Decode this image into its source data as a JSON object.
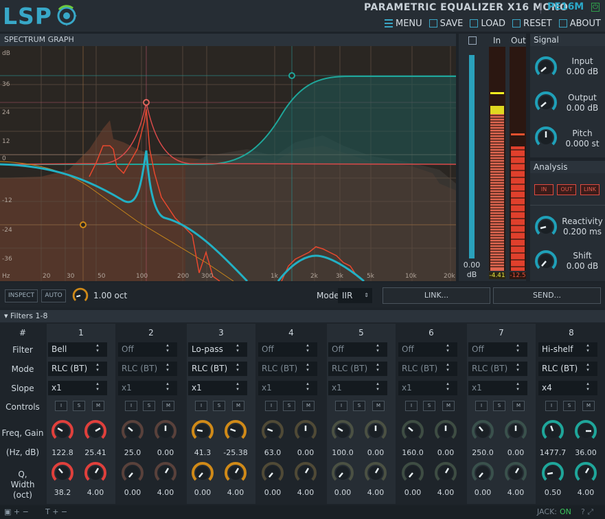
{
  "logo": {
    "text": "LSP"
  },
  "plugin": {
    "title": "PARAMETRIC EQUALIZER X16 MONO",
    "code": "PE16M"
  },
  "menu": [
    {
      "label": "MENU",
      "icon": "menu-icon"
    },
    {
      "label": "SAVE",
      "icon": "save-icon"
    },
    {
      "label": "LOAD",
      "icon": "load-icon"
    },
    {
      "label": "RESET",
      "icon": "reset-icon"
    },
    {
      "label": "ABOUT",
      "icon": "about-icon"
    }
  ],
  "graph": {
    "title": "SPECTRUM GRAPH",
    "y_unit": "dB",
    "x_unit": "Hz",
    "y_ticks": [
      "36",
      "24",
      "12",
      "0",
      "-12",
      "-24",
      "-36"
    ],
    "x_ticks": [
      "20",
      "30",
      "50",
      "100",
      "200",
      "300",
      "1k",
      "2k",
      "3k",
      "5k",
      "10k",
      "20k"
    ]
  },
  "zoom": {
    "value": "0.00",
    "unit": "dB"
  },
  "meters": {
    "in_label": "In",
    "out_label": "Out",
    "in_value": "-4.41",
    "out_value": "-12.5"
  },
  "signal": {
    "title": "Signal",
    "input": {
      "label": "Input",
      "value": "0.00 dB"
    },
    "output": {
      "label": "Output",
      "value": "0.00 dB"
    },
    "pitch": {
      "label": "Pitch",
      "value": "0.000 st"
    }
  },
  "analysis": {
    "title": "Analysis",
    "buttons": [
      "IN",
      "OUT",
      "LINK"
    ],
    "reactivity": {
      "label": "Reactivity",
      "value": "0.200 ms"
    },
    "shift": {
      "label": "Shift",
      "value": "0.00 dB"
    }
  },
  "toolbar": {
    "inspect": "INSPECT",
    "auto": "AUTO",
    "oct_value": "1.00 oct",
    "mode_label": "Mode",
    "mode_value": "IIR",
    "link": "LINK...",
    "send": "SEND..."
  },
  "filters": {
    "title": "Filters 1-8",
    "row_labels": {
      "num": "#",
      "filter": "Filter",
      "mode": "Mode",
      "slope": "Slope",
      "controls": "Controls",
      "freq_gain": "Freq, Gain",
      "hz_db": "(Hz, dB)",
      "q": "Q,",
      "width": "Width (oct)"
    },
    "ism": [
      "I",
      "S",
      "M"
    ],
    "columns": [
      {
        "num": "1",
        "filter": "Bell",
        "mode": "RLC (BT)",
        "slope": "x1",
        "freq": "122.8",
        "gain": "25.41",
        "q": "38.2",
        "width": "4.00",
        "color": "#e0403c",
        "active": true
      },
      {
        "num": "2",
        "filter": "Off",
        "mode": "RLC (BT)",
        "slope": "x1",
        "freq": "25.0",
        "gain": "0.00",
        "q": "0.00",
        "width": "4.00",
        "color": "#8a5a48",
        "active": false
      },
      {
        "num": "3",
        "filter": "Lo-pass",
        "mode": "RLC (BT)",
        "slope": "x1",
        "freq": "41.3",
        "gain": "-25.38",
        "q": "0.00",
        "width": "4.00",
        "color": "#d08a18",
        "active": true
      },
      {
        "num": "4",
        "filter": "Off",
        "mode": "RLC (BT)",
        "slope": "x1",
        "freq": "63.0",
        "gain": "0.00",
        "q": "0.00",
        "width": "4.00",
        "color": "#7a6a40",
        "active": false
      },
      {
        "num": "5",
        "filter": "Off",
        "mode": "RLC (BT)",
        "slope": "x1",
        "freq": "100.0",
        "gain": "0.00",
        "q": "0.00",
        "width": "4.00",
        "color": "#6a7050",
        "active": false
      },
      {
        "num": "6",
        "filter": "Off",
        "mode": "RLC (BT)",
        "slope": "x1",
        "freq": "160.0",
        "gain": "0.00",
        "q": "0.00",
        "width": "4.00",
        "color": "#5a7058",
        "active": false
      },
      {
        "num": "7",
        "filter": "Off",
        "mode": "RLC (BT)",
        "slope": "x1",
        "freq": "250.0",
        "gain": "0.00",
        "q": "0.00",
        "width": "4.00",
        "color": "#4a7060",
        "active": false
      },
      {
        "num": "8",
        "filter": "Hi-shelf",
        "mode": "RLC (BT)",
        "slope": "x4",
        "freq": "1477.7",
        "gain": "36.00",
        "q": "0.50",
        "width": "4.00",
        "color": "#1fa69a",
        "active": true
      }
    ]
  },
  "status": {
    "jack_label": "JACK:",
    "jack_value": "ON"
  }
}
